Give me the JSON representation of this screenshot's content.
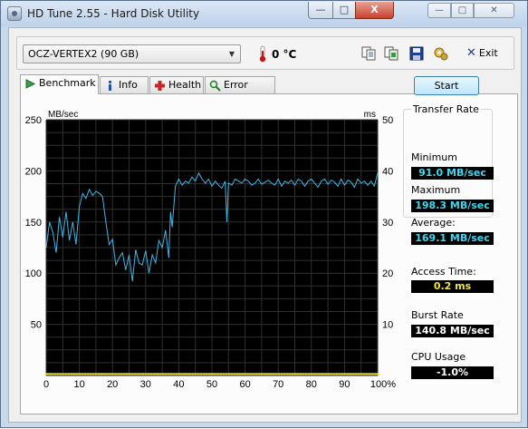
{
  "window": {
    "title": "HD Tune 2.55 - Hard Disk Utility",
    "caption_buttons": {
      "minimize": "—",
      "maximize": "□",
      "close": "X"
    },
    "inner_caption_buttons": {
      "minimize": "—",
      "maximize": "□",
      "close": "✕"
    }
  },
  "toolbar": {
    "drive": "OCZ-VERTEX2 (90 GB)",
    "temperature": "0 °C",
    "icons": [
      "copy-text-icon",
      "copy-screenshot-icon",
      "save-icon",
      "options-icon"
    ],
    "exit_label": "Exit"
  },
  "tabs": [
    {
      "label": "Benchmark",
      "icon": "benchmark-icon",
      "active": true
    },
    {
      "label": "Info",
      "icon": "info-icon",
      "active": false
    },
    {
      "label": "Health",
      "icon": "health-icon",
      "active": false
    },
    {
      "label": "Error Scan",
      "icon": "error-scan-icon",
      "active": false
    }
  ],
  "benchmark": {
    "start_label": "Start",
    "transfer_rate_title": "Transfer Rate",
    "minimum_label": "Minimum",
    "minimum_value": "91.0 MB/sec",
    "maximum_label": "Maximum",
    "maximum_value": "198.3 MB/sec",
    "average_label": "Average:",
    "average_value": "169.1 MB/sec",
    "access_time_label": "Access Time:",
    "access_time_value": "0.2 ms",
    "burst_rate_label": "Burst Rate",
    "burst_rate_value": "140.8 MB/sec",
    "cpu_usage_label": "CPU Usage",
    "cpu_usage_value": "-1.0%"
  },
  "colors": {
    "plot_background": "#000000",
    "grid": "#303030",
    "transfer_line": "#3fb6e8",
    "access_points": "#f2e63e",
    "readout_cyan": "#3fd7f2",
    "readout_yellow": "#f2e63e"
  },
  "chart_data": {
    "type": "line",
    "y_left_label": "MB/sec",
    "y_right_label": "ms",
    "y_left_ticks": [
      "250",
      "200",
      "150",
      "100",
      "50"
    ],
    "y_right_ticks": [
      "50",
      "40",
      "30",
      "20",
      "10"
    ],
    "x_ticks": [
      "0",
      "10",
      "20",
      "30",
      "40",
      "50",
      "60",
      "70",
      "80",
      "90",
      "100%"
    ],
    "xlim": [
      0,
      100
    ],
    "ylim_left": [
      0,
      250
    ],
    "ylim_right": [
      0,
      50
    ],
    "grid": true,
    "series": [
      {
        "x": [
          0,
          1,
          2,
          3,
          4,
          5,
          6,
          7,
          8,
          9,
          10,
          11,
          12,
          13,
          14,
          15,
          16,
          17,
          18,
          19,
          20,
          21,
          22,
          23,
          24,
          25,
          26,
          27,
          28,
          29,
          30,
          31,
          32,
          33,
          34,
          35,
          36,
          37,
          37.5,
          38,
          39,
          40,
          41,
          42,
          43,
          44,
          45,
          46,
          47,
          48,
          49,
          50,
          51,
          52,
          53,
          54,
          54.5,
          55,
          56,
          57,
          58,
          59,
          60,
          61,
          62,
          63,
          64,
          65,
          66,
          67,
          68,
          69,
          70,
          71,
          72,
          73,
          74,
          75,
          76,
          77,
          78,
          79,
          80,
          81,
          82,
          83,
          84,
          85,
          86,
          87,
          88,
          89,
          90,
          91,
          92,
          93,
          94,
          95,
          96,
          97,
          98,
          99,
          100
        ],
        "values": [
          125,
          150,
          140,
          120,
          155,
          135,
          160,
          132,
          150,
          128,
          165,
          178,
          173,
          182,
          176,
          180,
          178,
          175,
          150,
          128,
          133,
          108,
          115,
          120,
          103,
          118,
          92,
          123,
          110,
          108,
          122,
          100,
          118,
          110,
          132,
          125,
          142,
          115,
          160,
          145,
          185,
          192,
          186,
          190,
          188,
          194,
          190,
          198,
          192,
          188,
          192,
          185,
          190,
          186,
          183,
          190,
          150,
          188,
          186,
          192,
          190,
          188,
          192,
          190,
          186,
          188,
          192,
          187,
          189,
          191,
          188,
          186,
          192,
          185,
          190,
          188,
          191,
          186,
          192,
          190,
          185,
          190,
          192,
          188,
          184,
          190,
          192,
          187,
          191,
          189,
          185,
          192,
          186,
          191,
          189,
          184,
          192,
          188,
          190,
          186,
          190,
          185,
          198
        ]
      }
    ],
    "access_points_ms": [
      0.2
    ]
  }
}
